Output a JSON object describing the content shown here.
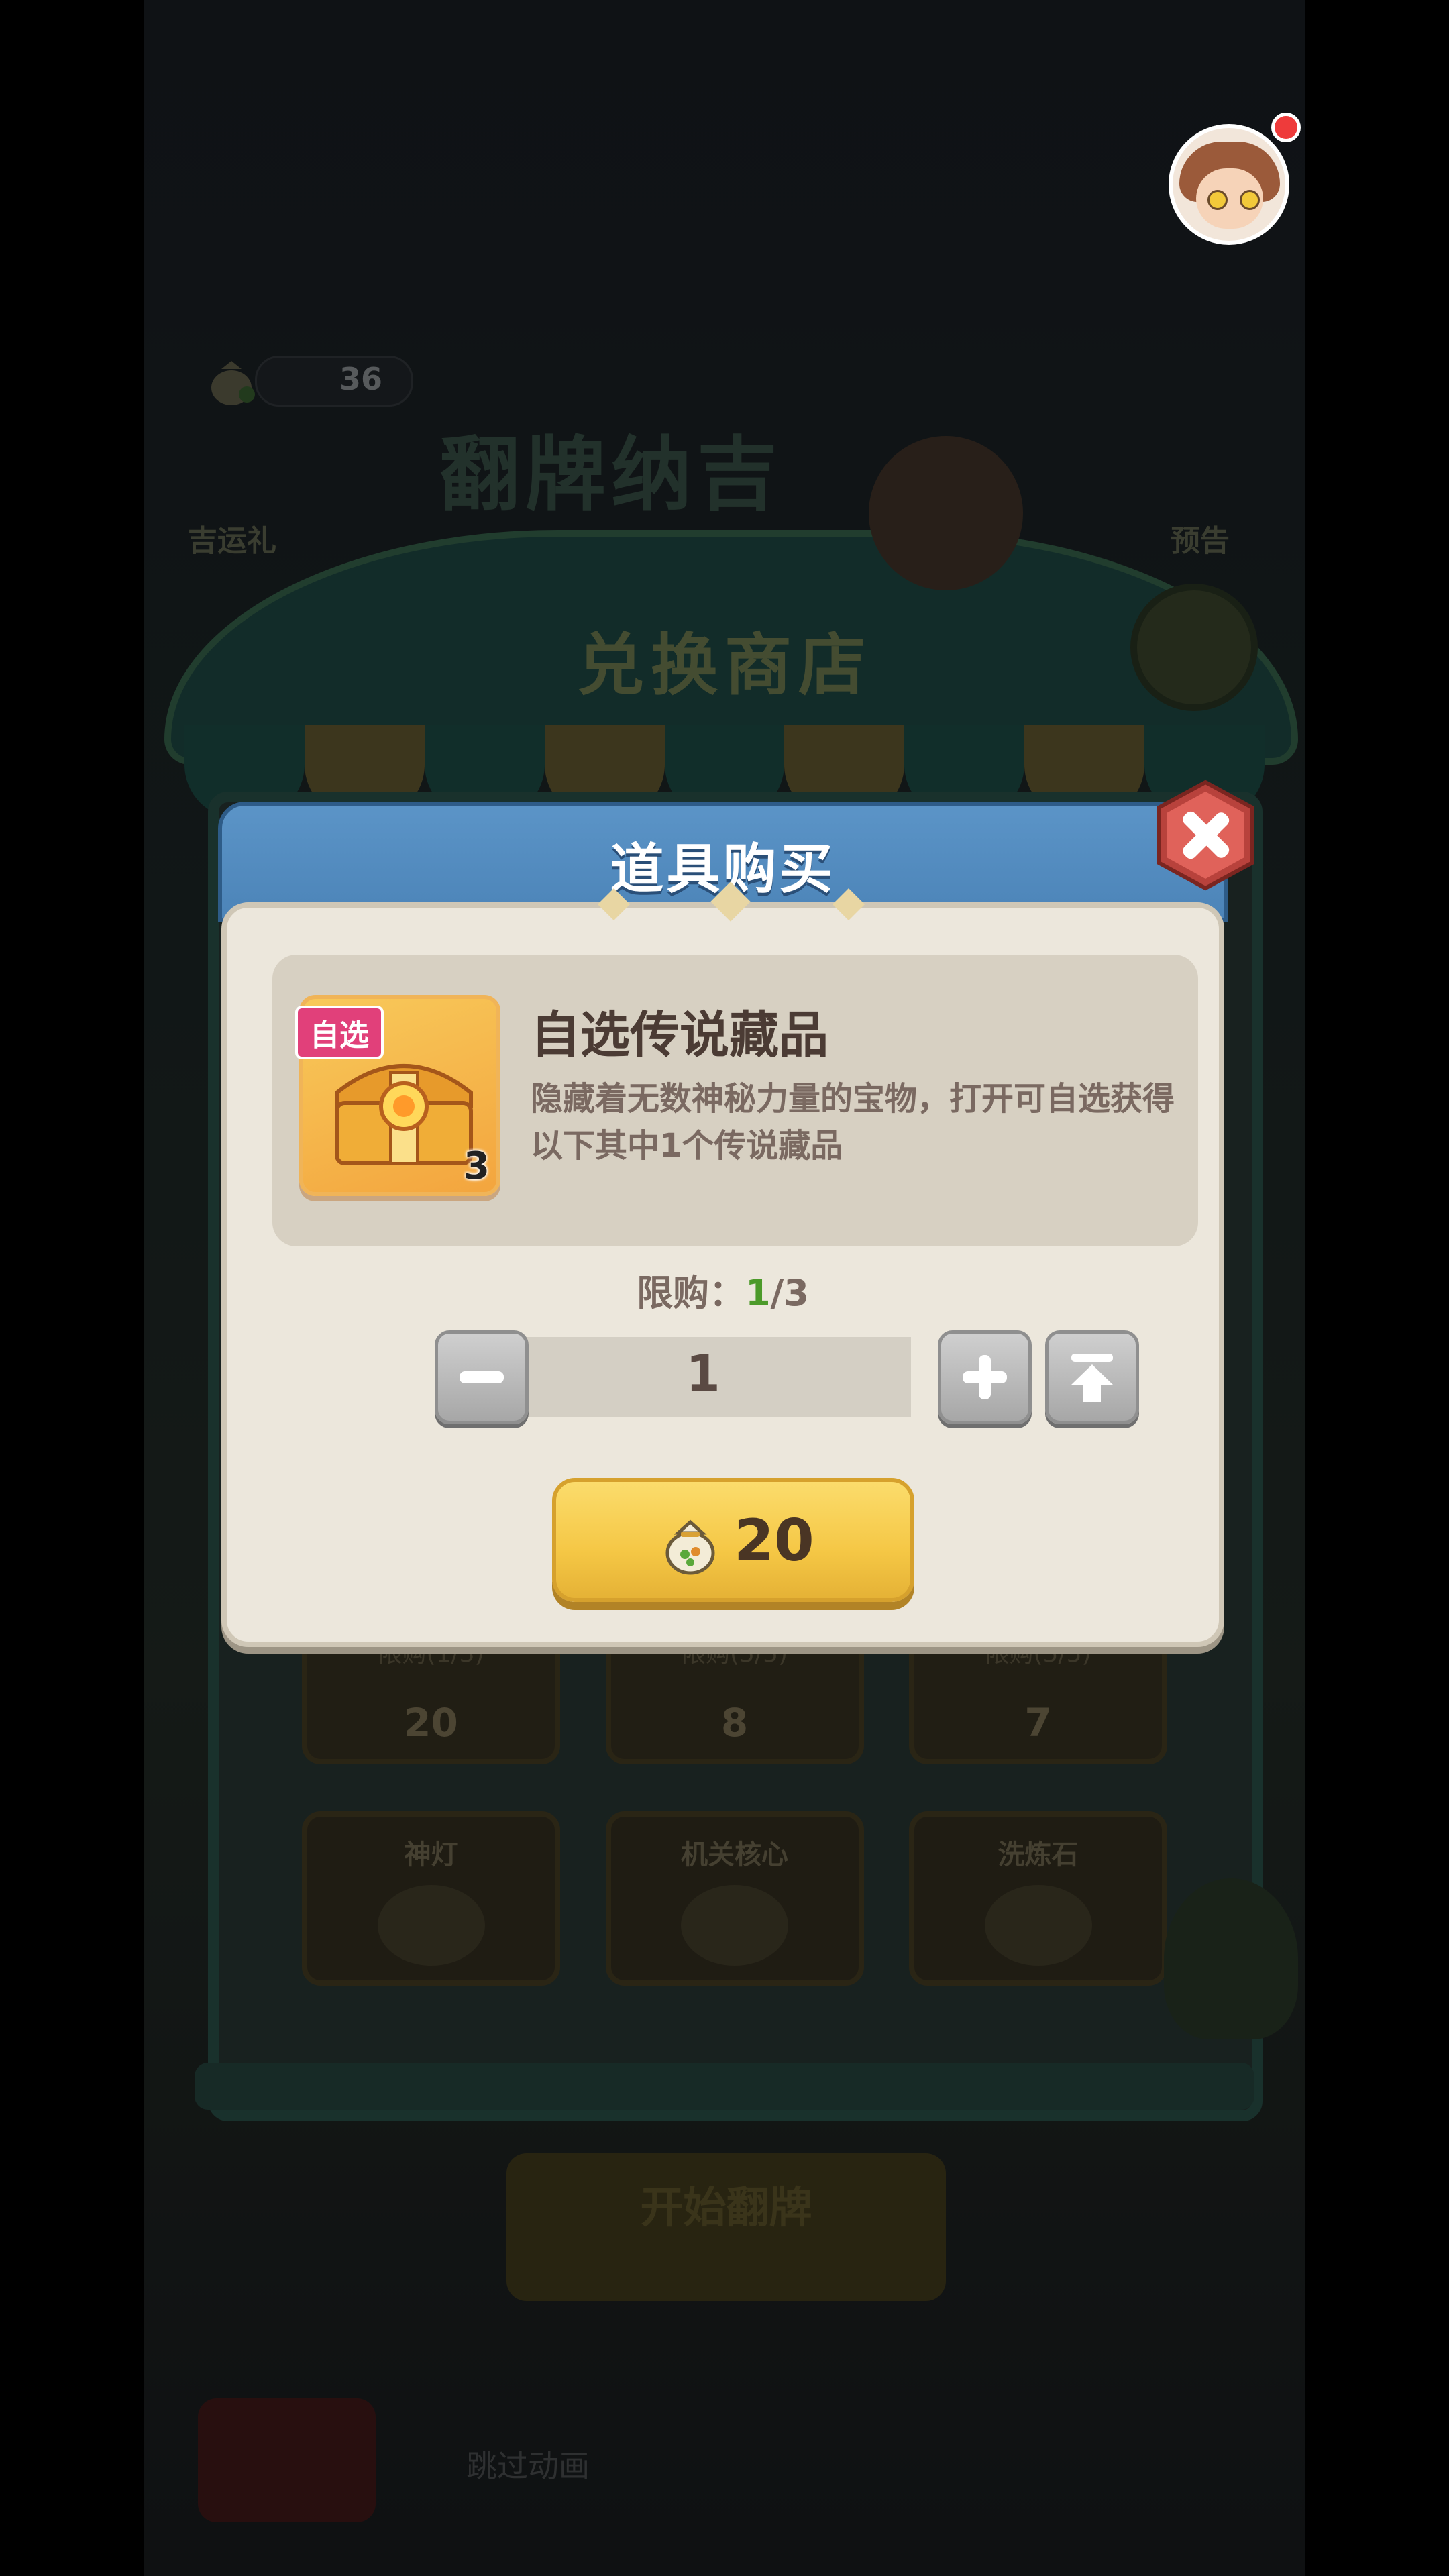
{
  "background": {
    "currency_count": "36",
    "left_label": "吉运礼",
    "right_label": "预告",
    "event_title": "翻牌纳吉",
    "shop_title": "兑换商店",
    "row1": [
      {
        "limit": "限购(1/3)",
        "price": "20"
      },
      {
        "limit": "限购(5/5)",
        "price": "8"
      },
      {
        "limit": "限购(5/5)",
        "price": "7"
      }
    ],
    "row2": [
      {
        "name": "神灯"
      },
      {
        "name": "机关核心"
      },
      {
        "name": "洗炼石"
      }
    ],
    "start_button": "开始翻牌",
    "skip_label": "跳过动画"
  },
  "modal": {
    "title": "道具购买",
    "item": {
      "tag": "自选",
      "count": "3",
      "name": "自选传说藏品",
      "description": "隐藏着无数神秘力量的宝物，打开可自选获得以下其中1个传说藏品"
    },
    "limit_label": "限购：",
    "limit_current": "1",
    "limit_total": "/3",
    "quantity": "1",
    "price": "20"
  },
  "colors": {
    "accent_green": "#4c9a2a",
    "modal_header": "#5b94c7",
    "buy_button": "#f5c745",
    "close_button": "#d9534f"
  },
  "icons": [
    "money-bag-icon",
    "close-icon",
    "minus-icon",
    "plus-icon",
    "max-icon",
    "treasure-chest-icon"
  ]
}
